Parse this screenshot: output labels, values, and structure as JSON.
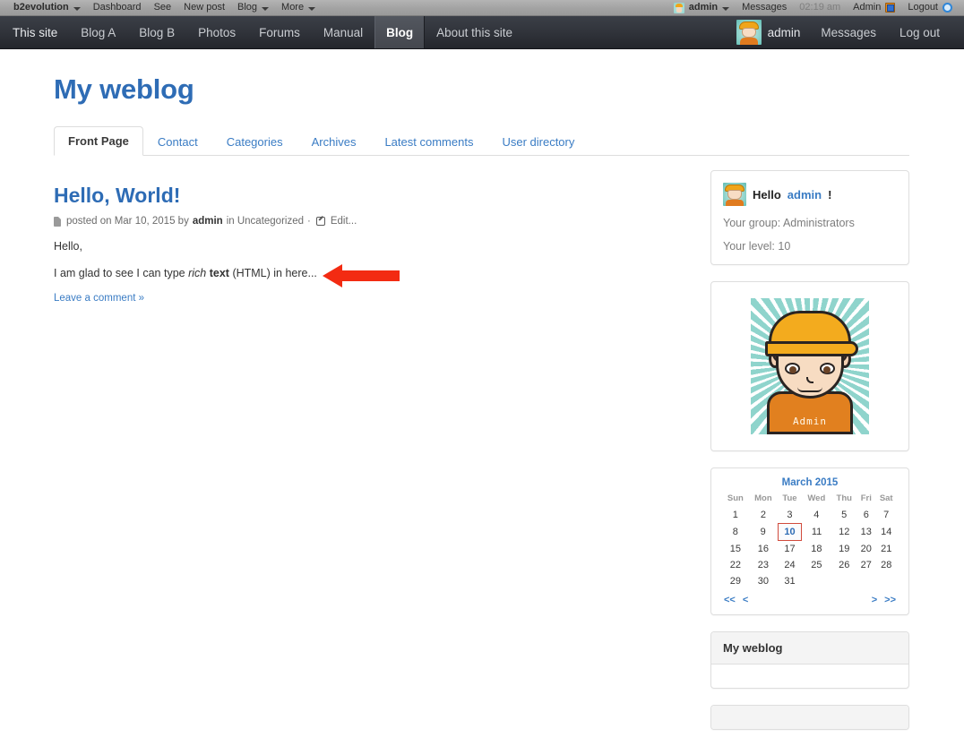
{
  "evobar": {
    "brand": "b2evolution",
    "left_items": [
      {
        "label": "Dashboard",
        "caret": false
      },
      {
        "label": "See",
        "caret": false
      },
      {
        "label": "New post",
        "caret": false
      },
      {
        "label": "Blog",
        "caret": true
      },
      {
        "label": "More",
        "caret": true
      }
    ],
    "user": "admin",
    "messages": "Messages",
    "time": "02:19 am",
    "admin": "Admin",
    "logout": "Logout"
  },
  "navbar": {
    "items": [
      {
        "label": "This site",
        "active": false
      },
      {
        "label": "Blog A",
        "active": false
      },
      {
        "label": "Blog B",
        "active": false
      },
      {
        "label": "Photos",
        "active": false
      },
      {
        "label": "Forums",
        "active": false
      },
      {
        "label": "Manual",
        "active": false
      },
      {
        "label": "Blog",
        "active": true
      },
      {
        "label": "About this site",
        "active": false
      }
    ],
    "user": "admin",
    "messages": "Messages",
    "logout": "Log out"
  },
  "blog": {
    "title": "My weblog",
    "tabs": [
      {
        "label": "Front Page",
        "active": true
      },
      {
        "label": "Contact",
        "active": false
      },
      {
        "label": "Categories",
        "active": false
      },
      {
        "label": "Archives",
        "active": false
      },
      {
        "label": "Latest comments",
        "active": false
      },
      {
        "label": "User directory",
        "active": false
      }
    ]
  },
  "post": {
    "title": "Hello, World!",
    "meta_posted_on": "posted on Mar 10, 2015 by",
    "meta_author": "admin",
    "meta_in": "in Uncategorized",
    "meta_sep": "·",
    "meta_edit": "Edit...",
    "para1": "Hello,",
    "para2_pre": "I am glad to see I can type ",
    "para2_italic": "rich",
    "para2_bold": "text",
    "para2_post": " (HTML) in here...",
    "leave_comment": "Leave a comment »"
  },
  "sidebar": {
    "user_info": {
      "hello": "Hello",
      "name": "admin",
      "bang": "!",
      "group": "Your group: Administrators",
      "level": "Your level: 10"
    },
    "avatar_label": "Admin",
    "calendar": {
      "caption": "March 2015",
      "weekdays": [
        "Sun",
        "Mon",
        "Tue",
        "Wed",
        "Thu",
        "Fri",
        "Sat"
      ],
      "weeks": [
        [
          "",
          "",
          "",
          "1",
          "2",
          "3",
          "4",
          "5",
          "6",
          "7"
        ],
        []
      ],
      "rows": [
        [
          "1",
          "2",
          "3",
          "4",
          "5",
          "6",
          "7"
        ],
        [
          "8",
          "9",
          "10",
          "11",
          "12",
          "13",
          "14"
        ],
        [
          "15",
          "16",
          "17",
          "18",
          "19",
          "20",
          "21"
        ],
        [
          "22",
          "23",
          "24",
          "25",
          "26",
          "27",
          "28"
        ],
        [
          "29",
          "30",
          "31",
          "",
          "",
          "",
          ""
        ]
      ],
      "selected_day": "10",
      "nav_first": "<<",
      "nav_prev": "<",
      "nav_next": ">",
      "nav_last": ">>"
    },
    "weblog_panel_title": "My weblog"
  },
  "colors": {
    "link_blue": "#3a7cc4",
    "title_blue": "#2e6cb5",
    "arrow_red": "#f32b12",
    "navbar_dark": "#31343b",
    "evobar_gray": "#a2a2a2",
    "calendar_highlight_border": "#d14b3c"
  }
}
